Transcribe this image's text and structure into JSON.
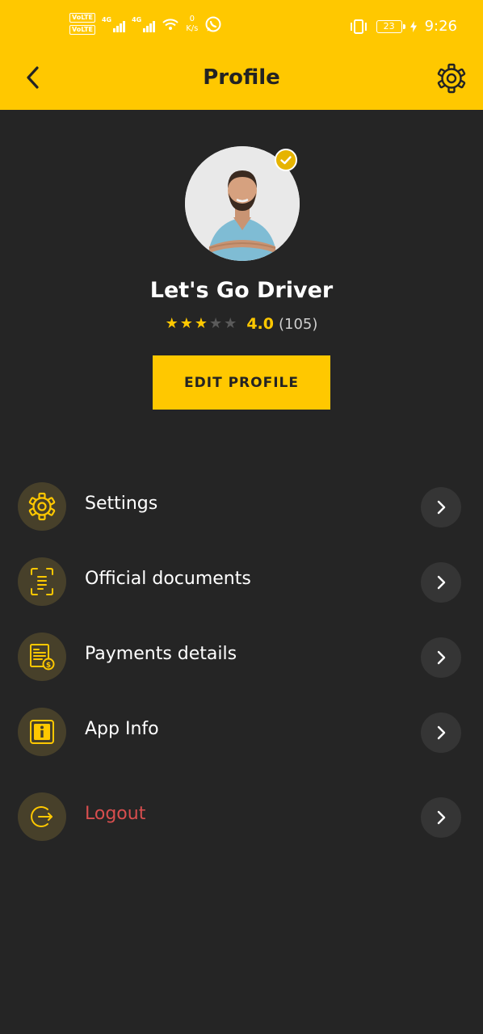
{
  "status_bar": {
    "volte1": "VoLTE",
    "volte2": "VoLTE",
    "net1": "4G",
    "net2": "4G",
    "speed_value": "0",
    "speed_unit": "K/s",
    "battery": "23",
    "time": "9:26"
  },
  "header": {
    "title": "Profile"
  },
  "profile": {
    "name": "Let's Go Driver",
    "rating_value": "4.0",
    "rating_count": "(105)",
    "stars_filled": 3,
    "stars_total": 5,
    "edit_label": "EDIT PROFILE"
  },
  "menu": [
    {
      "label": "Settings",
      "icon": "gear-icon"
    },
    {
      "label": "Official documents",
      "icon": "document-scan-icon"
    },
    {
      "label": "Payments details",
      "icon": "invoice-dollar-icon"
    },
    {
      "label": "App Info",
      "icon": "info-icon"
    },
    {
      "label": "Logout",
      "icon": "logout-icon"
    }
  ],
  "colors": {
    "accent": "#ffc800",
    "background": "#252525",
    "icon_bg": "#47402a",
    "arrow_bg": "#353535",
    "logout": "#d84e4e"
  }
}
